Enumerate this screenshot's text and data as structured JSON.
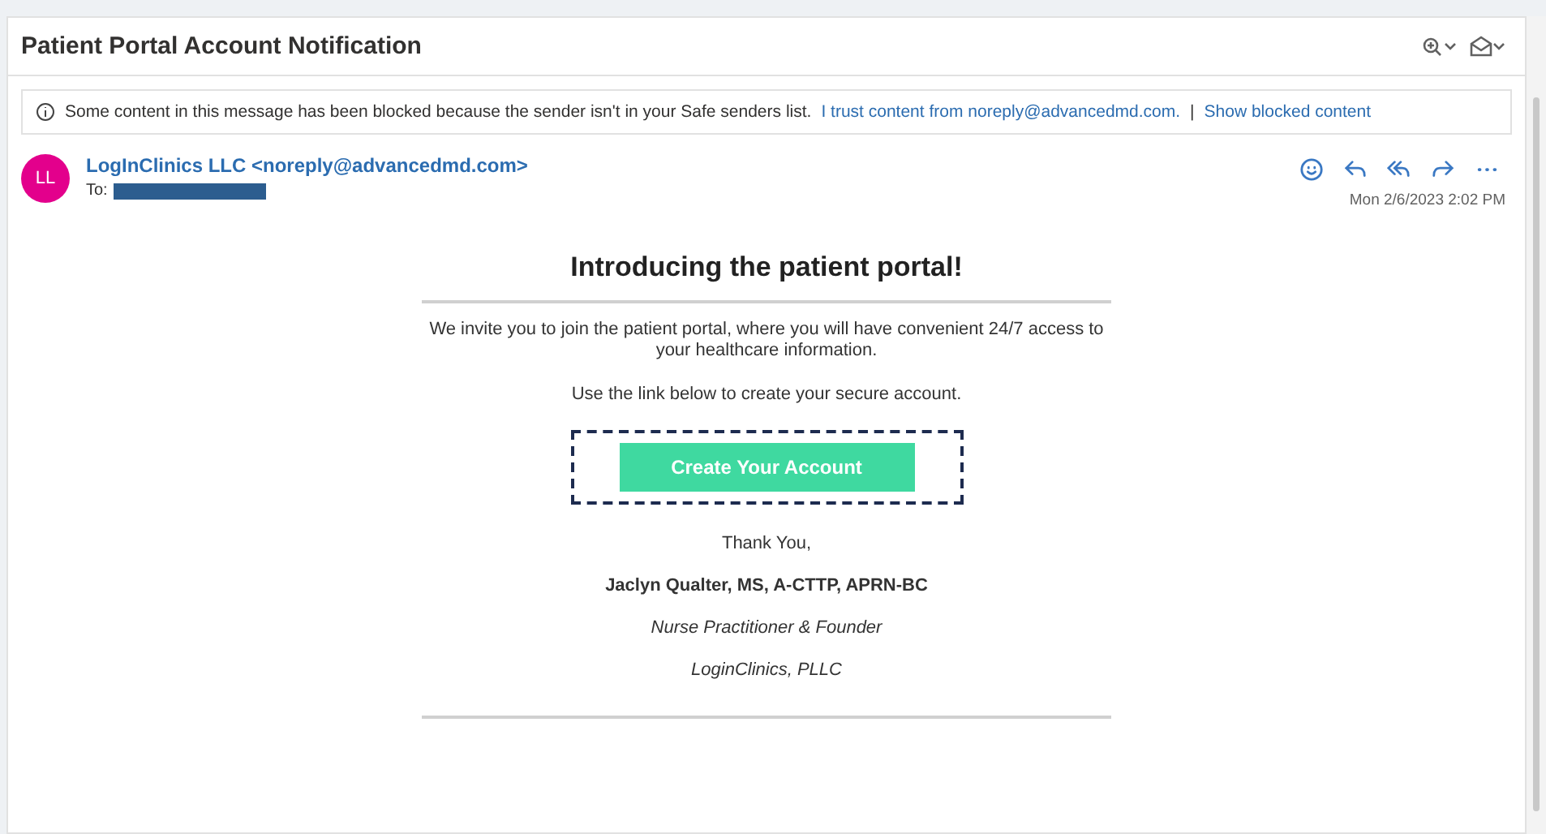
{
  "subject": "Patient Portal Account Notification",
  "notice": {
    "text": "Some content in this message has been blocked because the sender isn't in your Safe senders list.",
    "links": [
      "I trust content from noreply@advancedmd.com.",
      "Show blocked content"
    ],
    "separator": "|"
  },
  "sender": {
    "initials": "LL",
    "name": "LogInClinics LLC <noreply@advancedmd.com>",
    "to_label": "To:",
    "date": "Mon 2/6/2023 2:02 PM"
  },
  "body": {
    "heading": "Introducing the patient portal!",
    "intro": "We invite you to join the patient portal, where you will have convenient 24/7 access to your healthcare information.",
    "instruction": "Use the link below to create your secure account.",
    "button": "Create Your Account",
    "closing": "Thank You,",
    "signer": "Jaclyn Qualter, MS, A-CTTP, APRN-BC",
    "role": "Nurse Practitioner & Founder",
    "company": "LoginClinics, PLLC"
  }
}
